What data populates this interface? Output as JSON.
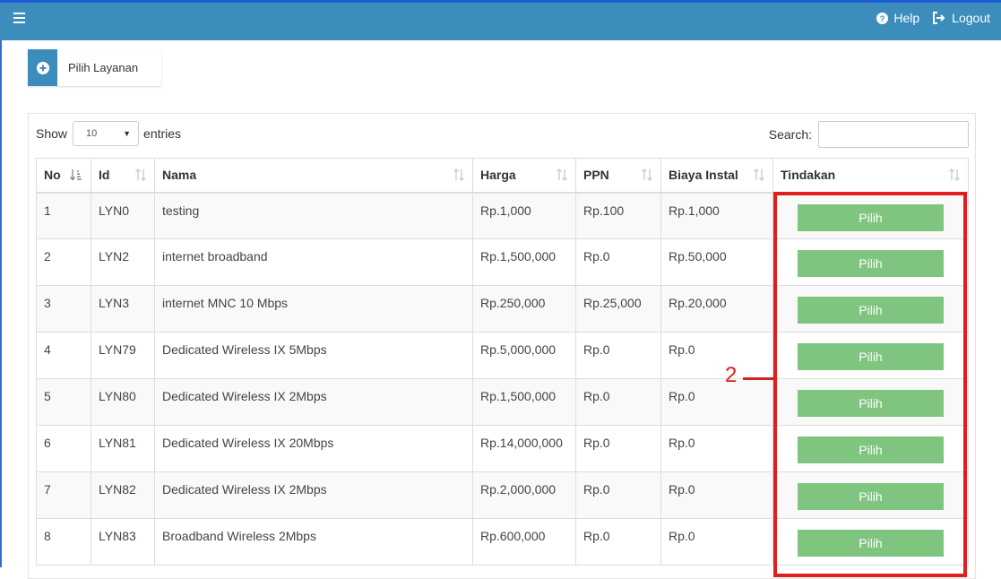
{
  "header": {
    "help_label": "Help",
    "logout_label": "Logout"
  },
  "action_button": {
    "label": "Pilih Layanan"
  },
  "table_controls": {
    "show_label": "Show",
    "page_size": "10",
    "entries_label": "entries",
    "search_label": "Search:",
    "search_value": ""
  },
  "table": {
    "columns": [
      "No",
      "Id",
      "Nama",
      "Harga",
      "PPN",
      "Biaya Instal",
      "Tindakan"
    ],
    "rows": [
      {
        "no": "1",
        "id": "LYN0",
        "nama": "testing",
        "harga": "Rp.1,000",
        "ppn": "Rp.100",
        "biaya": "Rp.1,000",
        "action": "Pilih"
      },
      {
        "no": "2",
        "id": "LYN2",
        "nama": "internet broadband",
        "harga": "Rp.1,500,000",
        "ppn": "Rp.0",
        "biaya": "Rp.50,000",
        "action": "Pilih"
      },
      {
        "no": "3",
        "id": "LYN3",
        "nama": "internet MNC 10 Mbps",
        "harga": "Rp.250,000",
        "ppn": "Rp.25,000",
        "biaya": "Rp.20,000",
        "action": "Pilih"
      },
      {
        "no": "4",
        "id": "LYN79",
        "nama": "Dedicated Wireless IX 5Mbps",
        "harga": "Rp.5,000,000",
        "ppn": "Rp.0",
        "biaya": "Rp.0",
        "action": "Pilih"
      },
      {
        "no": "5",
        "id": "LYN80",
        "nama": "Dedicated Wireless IX 2Mbps",
        "harga": "Rp.1,500,000",
        "ppn": "Rp.0",
        "biaya": "Rp.0",
        "action": "Pilih"
      },
      {
        "no": "6",
        "id": "LYN81",
        "nama": "Dedicated Wireless IX 20Mbps",
        "harga": "Rp.14,000,000",
        "ppn": "Rp.0",
        "biaya": "Rp.0",
        "action": "Pilih"
      },
      {
        "no": "7",
        "id": "LYN82",
        "nama": "Dedicated Wireless IX 2Mbps",
        "harga": "Rp.2,000,000",
        "ppn": "Rp.0",
        "biaya": "Rp.0",
        "action": "Pilih"
      },
      {
        "no": "8",
        "id": "LYN83",
        "nama": "Broadband Wireless 2Mbps",
        "harga": "Rp.600,000",
        "ppn": "Rp.0",
        "biaya": "Rp.0",
        "action": "Pilih"
      }
    ]
  },
  "annotation": {
    "label": "2",
    "color": "#e11d1d"
  },
  "colors": {
    "header_bg": "#3c8dbc",
    "button_green": "#7fc47f"
  }
}
